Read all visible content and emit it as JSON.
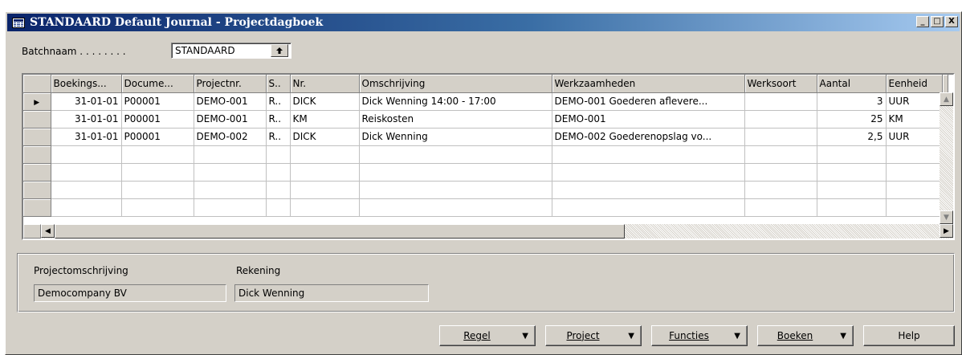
{
  "window": {
    "title": "STANDAARD Default Journal - Projectdagboek",
    "controls": {
      "minimize": "_",
      "maximize": "□",
      "close": "X"
    }
  },
  "batch": {
    "label": "Batchnaam . . . . . . . .",
    "value": "STANDAARD",
    "lookup_icon": "up-arrow-icon"
  },
  "grid": {
    "columns": [
      "Boekings...",
      "Docume...",
      "Projectnr.",
      "S..",
      "Nr.",
      "Omschrijving",
      "Werkzaamheden",
      "Werksoort",
      "Aantal",
      "Eenheid"
    ],
    "rows": [
      [
        "31-01-01",
        "P00001",
        "DEMO-001",
        "R..",
        "DICK",
        "Dick Wenning 14:00 - 17:00",
        "DEMO-001 Goederen aflevere...",
        "",
        "3",
        "UUR"
      ],
      [
        "31-01-01",
        "P00001",
        "DEMO-001",
        "R..",
        "KM",
        "Reiskosten",
        "DEMO-001",
        "",
        "25",
        "KM"
      ],
      [
        "31-01-01",
        "P00001",
        "DEMO-002",
        "R..",
        "DICK",
        "Dick Wenning",
        "DEMO-002 Goederenopslag vo...",
        "",
        "2,5",
        "UUR"
      ],
      [
        "",
        "",
        "",
        "",
        "",
        "",
        "",
        "",
        "",
        ""
      ],
      [
        "",
        "",
        "",
        "",
        "",
        "",
        "",
        "",
        "",
        ""
      ],
      [
        "",
        "",
        "",
        "",
        "",
        "",
        "",
        "",
        "",
        ""
      ],
      [
        "",
        "",
        "",
        "",
        "",
        "",
        "",
        "",
        "",
        ""
      ]
    ],
    "current_row_marker": "▶"
  },
  "info": {
    "project_label": "Projectomschrijving",
    "project_value": "Democompany BV",
    "account_label": "Rekening",
    "account_value": "Dick Wenning"
  },
  "buttons": {
    "regel": "Regel",
    "project": "Project",
    "functies": "Functies",
    "boeken": "Boeken",
    "help": "Help",
    "caret": "▼"
  }
}
